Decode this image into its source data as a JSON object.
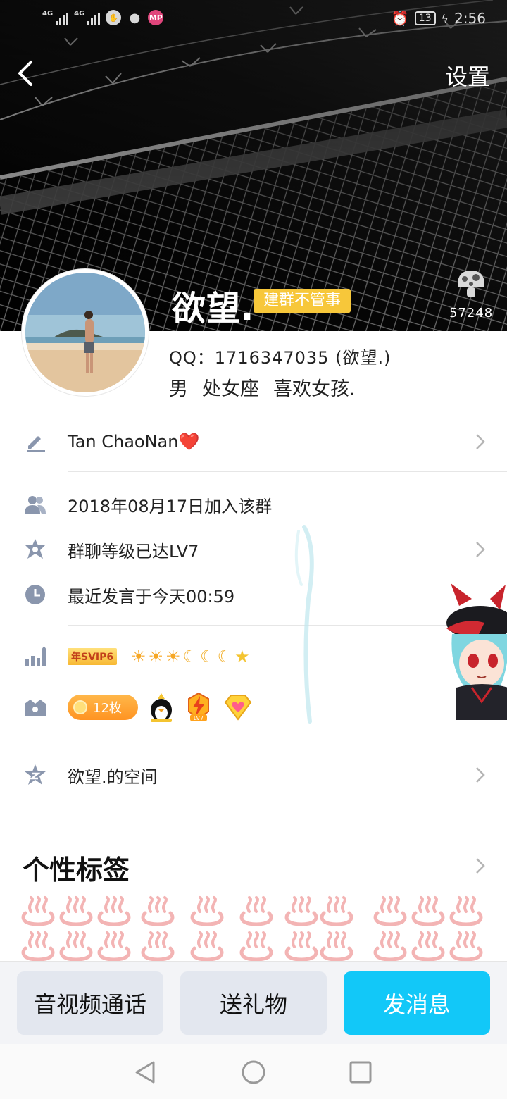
{
  "status_bar": {
    "network_1": "4G",
    "network_2": "4G",
    "battery": "13",
    "time": "2:56",
    "app_icons": [
      "hand-icon",
      "wechat-icon",
      "mp-icon"
    ]
  },
  "header": {
    "settings_label": "设置",
    "visitor_count": "57248",
    "nickname": "欲望.",
    "group_title": "建群不管事"
  },
  "profile": {
    "qq_line": "QQ：1716347035 (欲望.)",
    "gender": "男",
    "zodiac": "处女座",
    "signature": "喜欢女孩."
  },
  "rows": {
    "group_nickname": "Tan ChaoNan❤️",
    "join_date": "2018年08月17日加入该群",
    "group_level": "群聊等级已达LV7",
    "last_speak": "最近发言于今天00:59",
    "svip_badge": "年SVIP6",
    "level_icons": [
      "☀",
      "☀",
      "☀",
      "☾",
      "☾",
      "☾",
      "★"
    ],
    "coin_count": "12枚",
    "space_link": "欲望.的空间"
  },
  "section": {
    "title": "个性标签"
  },
  "actions": {
    "call": "音视频通话",
    "gift": "送礼物",
    "message": "发消息"
  },
  "colors": {
    "accent": "#12c8f8",
    "group_tag": "#f7c73a",
    "coin_badge": "#ff9e2c",
    "svip_text": "#c2401b"
  }
}
